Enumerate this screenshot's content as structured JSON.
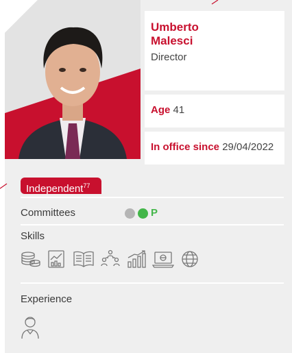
{
  "profile": {
    "first_name": "Umberto",
    "last_name": "Malesci",
    "role": "Director",
    "age_label": "Age",
    "age_value": "41",
    "office_label": "In office since",
    "office_value": "29/04/2022",
    "badge_label": "Independent",
    "badge_note": "77"
  },
  "sections": {
    "committees": "Committees",
    "committee_tag": "P",
    "skills": "Skills",
    "experience": "Experience"
  },
  "colors": {
    "accent": "#c8102e",
    "committee_active": "#43b649",
    "committee_inactive": "#b5b5b5",
    "background": "#efefef"
  },
  "icons": {
    "skills": [
      "coins-finance-icon",
      "report-chart-icon",
      "open-book-icon",
      "team-network-icon",
      "growth-bars-icon",
      "laptop-digital-icon",
      "globe-icon"
    ],
    "experience": [
      "person-icon"
    ]
  }
}
